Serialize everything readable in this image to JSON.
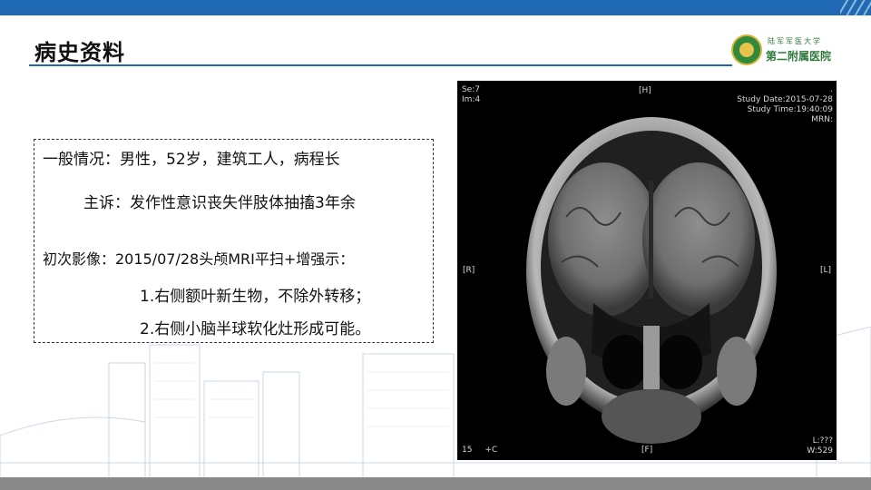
{
  "slide": {
    "title": "病史资料",
    "logo": {
      "motto": "陆军军医大学",
      "name": "第二附属医院"
    }
  },
  "info": {
    "general": "一般情况：男性，52岁，建筑工人，病程长",
    "complaint": "主诉：发作性意识丧失伴肢体抽搐3年余",
    "imaging_header": "初次影像：2015/07/28头颅MRI平扫+增强示：",
    "finding_1": "1.右侧额叶新生物，不除外转移；",
    "finding_2": "2.右侧小脑半球软化灶形成可能。"
  },
  "mri": {
    "series": "Se:7",
    "image": "Im:4",
    "top_marker": "[H]",
    "dot": ".",
    "study_date": "Study Date:2015-07-28",
    "study_time": "Study Time:19:40:09",
    "mrn": "MRN:",
    "left_marker": "[R]",
    "right_marker": "[L]",
    "bottom_marker": "[F]",
    "slice_number": "15",
    "contrast": "+C",
    "window_level": "L:???",
    "window_width": "W:529"
  },
  "colors": {
    "accent": "#1f6ab3",
    "logo_green": "#2f7a3a",
    "bottom_bar": "#8a8a8a"
  }
}
